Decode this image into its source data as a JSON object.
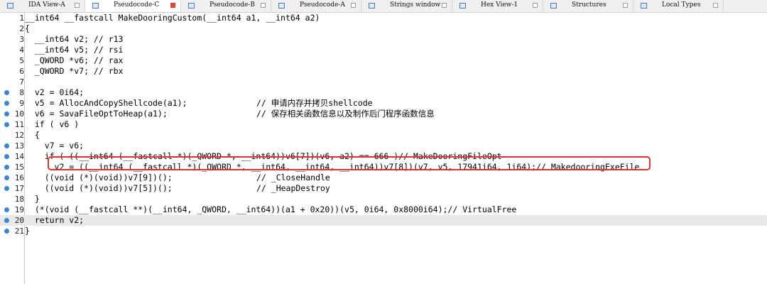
{
  "tabs": [
    {
      "label": "IDA View-A",
      "icon": "ida-view-icon",
      "active": false,
      "width": 120
    },
    {
      "label": "Pseudocode-C",
      "icon": "pseudocode-icon",
      "active": true,
      "width": 135
    },
    {
      "label": "Pseudocode-B",
      "icon": "pseudocode-icon",
      "active": false,
      "width": 127
    },
    {
      "label": "Pseudocode-A",
      "icon": "pseudocode-icon",
      "active": false,
      "width": 127
    },
    {
      "label": "Strings window",
      "icon": "strings-icon",
      "active": false,
      "width": 128
    },
    {
      "label": "Hex View-1",
      "icon": "hex-view-icon",
      "active": false,
      "width": 128
    },
    {
      "label": "Structures",
      "icon": "structures-icon",
      "active": false,
      "width": 127
    },
    {
      "label": "Local Types",
      "icon": "local-types-icon",
      "active": false,
      "width": 127
    }
  ],
  "lines": [
    {
      "num": "1",
      "bp": false,
      "text": "__int64 __fastcall MakeDooringCustom(__int64 a1, __int64 a2)",
      "comment": ""
    },
    {
      "num": "2",
      "bp": false,
      "text": "{",
      "comment": ""
    },
    {
      "num": "3",
      "bp": false,
      "text": "  __int64 v2; // r13",
      "comment": ""
    },
    {
      "num": "4",
      "bp": false,
      "text": "  __int64 v5; // rsi",
      "comment": ""
    },
    {
      "num": "5",
      "bp": false,
      "text": "  _QWORD *v6; // rax",
      "comment": ""
    },
    {
      "num": "6",
      "bp": false,
      "text": "  _QWORD *v7; // rbx",
      "comment": ""
    },
    {
      "num": "7",
      "bp": false,
      "text": "",
      "comment": ""
    },
    {
      "num": "8",
      "bp": true,
      "text": "  v2 = 0i64;",
      "comment": ""
    },
    {
      "num": "9",
      "bp": true,
      "text": "  v5 = AllocAndCopyShellcode(a1);",
      "comment": "// 申请内存并拷贝shellcode"
    },
    {
      "num": "10",
      "bp": true,
      "text": "  v6 = SavaFileOptToHeap(a1);",
      "comment": "// 保存相关函数信息以及制作后门程序函数信息"
    },
    {
      "num": "11",
      "bp": true,
      "text": "  if ( v6 )",
      "comment": ""
    },
    {
      "num": "12",
      "bp": false,
      "text": "  {",
      "comment": ""
    },
    {
      "num": "13",
      "bp": true,
      "text": "    v7 = v6;",
      "comment": ""
    },
    {
      "num": "14",
      "bp": true,
      "text": "    if ( ((__int64 (__fastcall *)(_QWORD *, __int64))v6[7])(v6, a2) == 666 )// MakeDooringFileOpt",
      "comment": ""
    },
    {
      "num": "15",
      "bp": true,
      "text": "      v2 = ((__int64 (__fastcall *)(_QWORD *, __int64, __int64, __int64))v7[8])(v7, v5, 17941i64, 1i64);// MakedooringExeFile",
      "comment": ""
    },
    {
      "num": "16",
      "bp": true,
      "text": "    ((void (*)(void))v7[9])();",
      "comment": "// _CloseHandle"
    },
    {
      "num": "17",
      "bp": true,
      "text": "    ((void (*)(void))v7[5])();",
      "comment": "// _HeapDestroy"
    },
    {
      "num": "18",
      "bp": false,
      "text": "  }",
      "comment": ""
    },
    {
      "num": "19",
      "bp": true,
      "text": "  (*(void (__fastcall **)(__int64, _QWORD, __int64))(a1 + 0x20))(v5, 0i64, 0x8000i64);// VirtualFree",
      "comment": ""
    },
    {
      "num": "20",
      "bp": true,
      "text": "  return v2;",
      "comment": ""
    },
    {
      "num": "21",
      "bp": true,
      "text": "}",
      "comment": ""
    }
  ],
  "highlighted_line": "20",
  "colors": {
    "breakpoint": "#3a86d6",
    "annotation_box": "#e0302a",
    "current_line": "#e8e8e8"
  }
}
